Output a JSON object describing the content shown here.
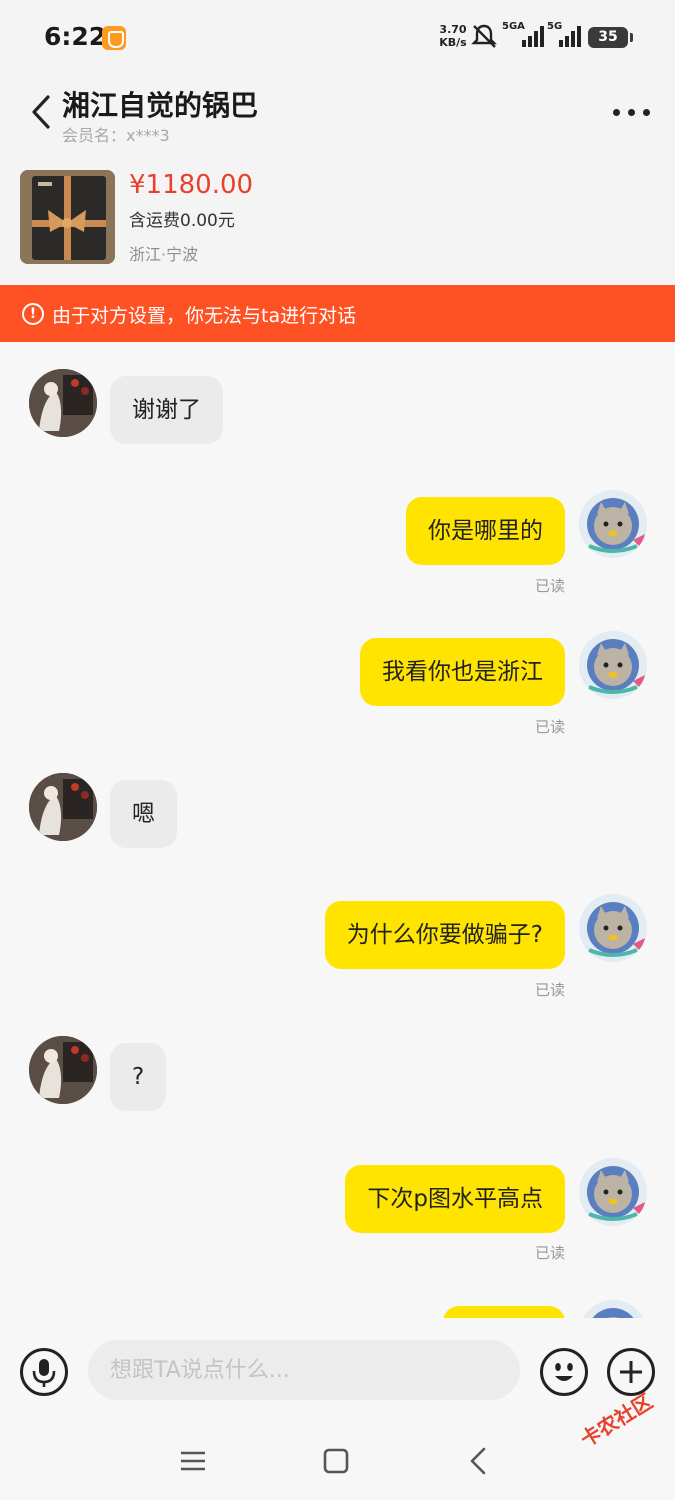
{
  "status_bar": {
    "time": "6:22",
    "net_speed": "3.70",
    "net_unit": "KB/s",
    "sim1_label": "5GA",
    "sim2_label": "5G",
    "battery": "35"
  },
  "header": {
    "title": "湘江自觉的锅巴",
    "member": "会员名：x***3"
  },
  "product": {
    "price": "¥1180.00",
    "shipping": "含运费0.00元",
    "location": "浙江·宁波"
  },
  "notice": {
    "icon": "!",
    "text": "由于对方设置，你无法与ta进行对话"
  },
  "messages": [
    {
      "side": "in",
      "text": "谢谢了"
    },
    {
      "side": "out",
      "text": "你是哪里的",
      "status": "已读"
    },
    {
      "side": "out",
      "text": "我看你也是浙江",
      "status": "已读"
    },
    {
      "side": "in",
      "text": "嗯"
    },
    {
      "side": "out",
      "text": "为什么你要做骗子?",
      "status": "已读"
    },
    {
      "side": "in",
      "text": "?"
    },
    {
      "side": "out",
      "text": "下次p图水平高点",
      "status": "已读"
    }
  ],
  "input": {
    "placeholder": "想跟TA说点什么..."
  },
  "watermark": "卡农社区",
  "colors": {
    "accent": "#ff5224",
    "price": "#e8402a",
    "my_bubble": "#ffe400",
    "their_bubble": "#ebebeb"
  }
}
